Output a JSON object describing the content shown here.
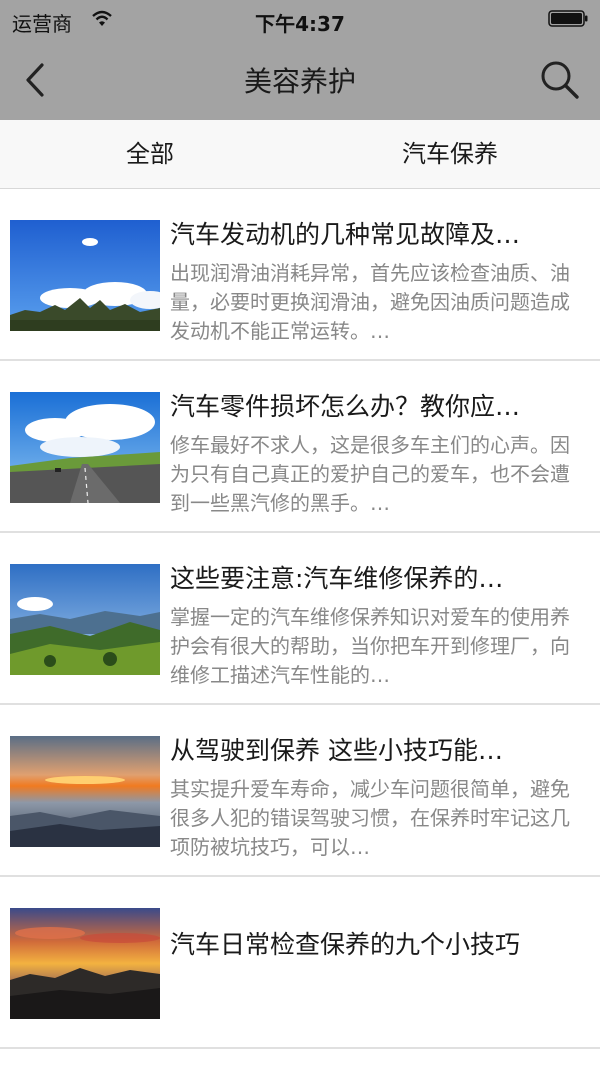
{
  "status_bar": {
    "carrier": "运营商",
    "time": "下午4:37"
  },
  "nav": {
    "title": "美容养护"
  },
  "tabs": [
    {
      "label": "全部"
    },
    {
      "label": "汽车保养"
    }
  ],
  "articles": [
    {
      "title": "汽车发动机的几种常见故障及…",
      "desc": "出现润滑油消耗异常，首先应该检查油质、油量，必要时更换润滑油，避免因油质问题造成发动机不能正常运转。…",
      "thumb": "blue-sky-clouds-rocks"
    },
    {
      "title": "汽车零件损坏怎么办？教你应…",
      "desc": "修车最好不求人，这是很多车主们的心声。因为只有自己真正的爱护自己的爱车，也不会遭到一些黑汽修的黑手。…",
      "thumb": "highway-clouds"
    },
    {
      "title": "这些要注意:汽车维修保养的…",
      "desc": "掌握一定的汽车维修保养知识对爱车的使用养护会有很大的帮助，当你把车开到修理厂，向维修工描述汽车性能的…",
      "thumb": "mountain-valley"
    },
    {
      "title": "从驾驶到保养 这些小技巧能…",
      "desc": "其实提升爱车寿命，减少车问题很简单，避免很多人犯的错误驾驶习惯，在保养时牢记这几项防被坑技巧，可以…",
      "thumb": "sunset-sea-of-clouds"
    },
    {
      "title": "汽车日常检查保养的九个小技巧",
      "desc": "",
      "thumb": "sunset-mountains"
    }
  ]
}
